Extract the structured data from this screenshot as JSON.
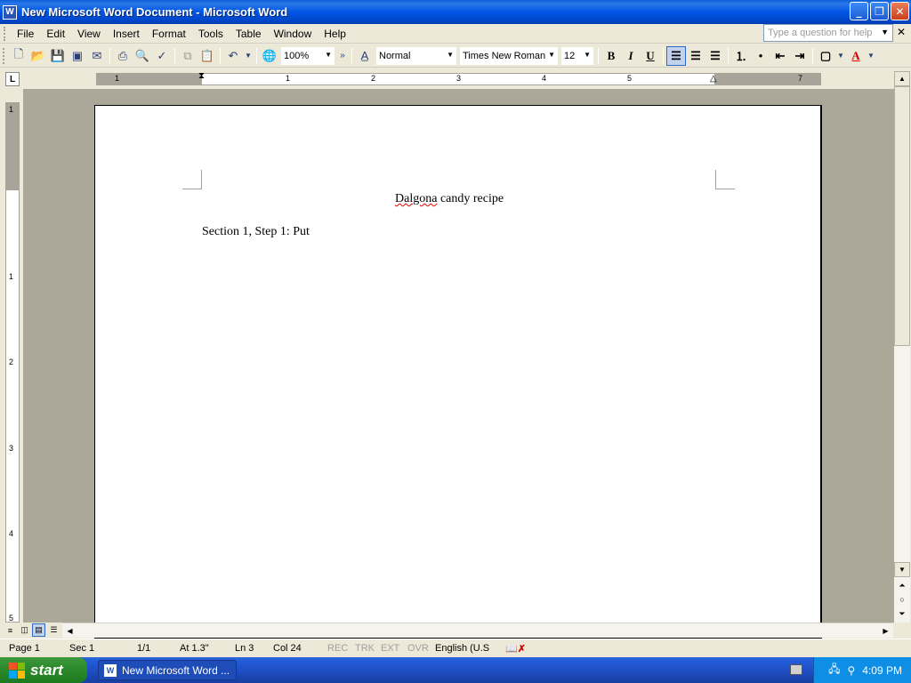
{
  "window": {
    "title": "New Microsoft Word Document - Microsoft Word",
    "app_icon": "W"
  },
  "menu": {
    "items": [
      "File",
      "Edit",
      "View",
      "Insert",
      "Format",
      "Tools",
      "Table",
      "Window",
      "Help"
    ],
    "help_placeholder": "Type a question for help"
  },
  "toolbar": {
    "zoom": "100%",
    "style": "Normal",
    "font": "Times New Roman",
    "size": "12",
    "bold": "B",
    "italic": "I",
    "underline": "U"
  },
  "ruler": {
    "tab_selector": "L",
    "h_labels": [
      "1",
      "1",
      "2",
      "3",
      "4",
      "5",
      "7"
    ],
    "v_labels": [
      "1",
      "1",
      "2",
      "3",
      "4",
      "5"
    ]
  },
  "document": {
    "title_word": "Dalgona",
    "title_rest": " candy recipe",
    "line1": "Section 1, Step 1: Put"
  },
  "status": {
    "page": "Page  1",
    "sec": "Sec  1",
    "pages": "1/1",
    "at": "At  1.3\"",
    "ln": "Ln  3",
    "col": "Col  24",
    "rec": "REC",
    "trk": "TRK",
    "ext": "EXT",
    "ovr": "OVR",
    "language": "English (U.S"
  },
  "taskbar": {
    "start_label": "start",
    "task_label": "New Microsoft Word ...",
    "clock": "4:09 PM"
  }
}
